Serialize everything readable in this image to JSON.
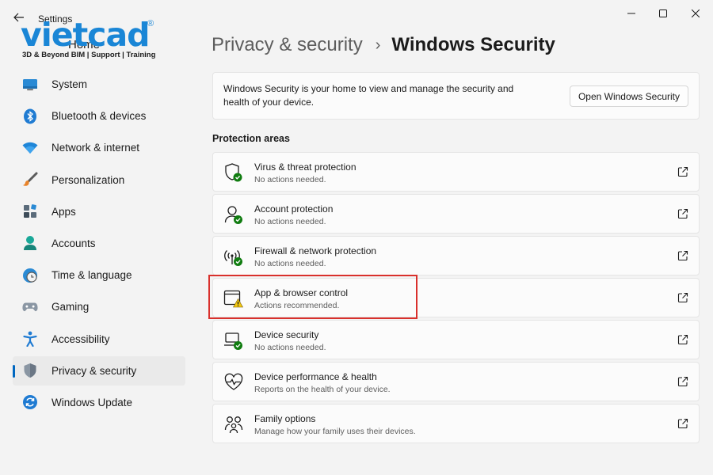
{
  "window": {
    "title": "Settings"
  },
  "watermark": {
    "logo": "vietcad",
    "registered": "®",
    "tagline": "3D & Beyond BIM | Support | Training",
    "home_label": "Home"
  },
  "sidebar": {
    "items": [
      {
        "label": "System",
        "icon": "system-icon"
      },
      {
        "label": "Bluetooth & devices",
        "icon": "bluetooth-icon"
      },
      {
        "label": "Network & internet",
        "icon": "wifi-icon"
      },
      {
        "label": "Personalization",
        "icon": "brush-icon"
      },
      {
        "label": "Apps",
        "icon": "apps-icon"
      },
      {
        "label": "Accounts",
        "icon": "accounts-icon"
      },
      {
        "label": "Time & language",
        "icon": "globe-clock-icon"
      },
      {
        "label": "Gaming",
        "icon": "gamepad-icon"
      },
      {
        "label": "Accessibility",
        "icon": "accessibility-icon"
      },
      {
        "label": "Privacy & security",
        "icon": "shield-icon",
        "active": true
      },
      {
        "label": "Windows Update",
        "icon": "update-icon"
      }
    ]
  },
  "breadcrumb": {
    "parent": "Privacy & security",
    "separator": "›",
    "current": "Windows Security"
  },
  "info": {
    "text": "Windows Security is your home to view and manage the security and health of your device.",
    "button": "Open Windows Security"
  },
  "section": {
    "title": "Protection areas"
  },
  "areas": [
    {
      "title": "Virus & threat protection",
      "status": "No actions needed.",
      "icon": "virus-shield-icon"
    },
    {
      "title": "Account protection",
      "status": "No actions needed.",
      "icon": "account-protection-icon"
    },
    {
      "title": "Firewall & network protection",
      "status": "No actions needed.",
      "icon": "firewall-icon"
    },
    {
      "title": "App & browser control",
      "status": "Actions recommended.",
      "icon": "app-browser-icon",
      "warning": true
    },
    {
      "title": "Device security",
      "status": "No actions needed.",
      "icon": "device-security-icon"
    },
    {
      "title": "Device performance & health",
      "status": "Reports on the health of your device.",
      "icon": "heart-icon"
    },
    {
      "title": "Family options",
      "status": "Manage how your family uses their devices.",
      "icon": "family-icon"
    }
  ],
  "colors": {
    "accent": "#0067c0",
    "ok": "#107c10",
    "warning": "#f2c811",
    "highlight": "#d9302c",
    "watermark": "#1a86d6"
  }
}
